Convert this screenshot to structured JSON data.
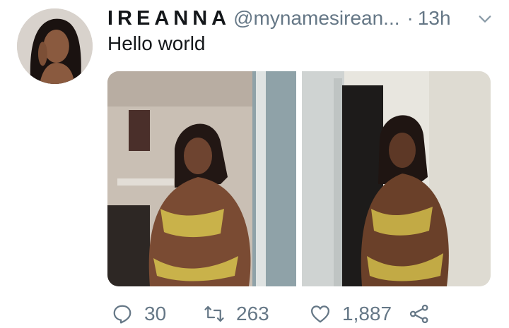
{
  "tweet": {
    "display_name": "IREANNA",
    "handle": "@mynamesirean...",
    "separator": "·",
    "time": "13h",
    "text": "Hello world"
  },
  "actions": {
    "replies": "30",
    "retweets": "263",
    "likes": "1,887"
  },
  "icons": {
    "reply": "reply-icon",
    "retweet": "retweet-icon",
    "like": "heart-icon",
    "share": "share-icon",
    "menu": "chevron-down-icon"
  },
  "colors": {
    "text": "#14171a",
    "secondary": "#657786"
  }
}
